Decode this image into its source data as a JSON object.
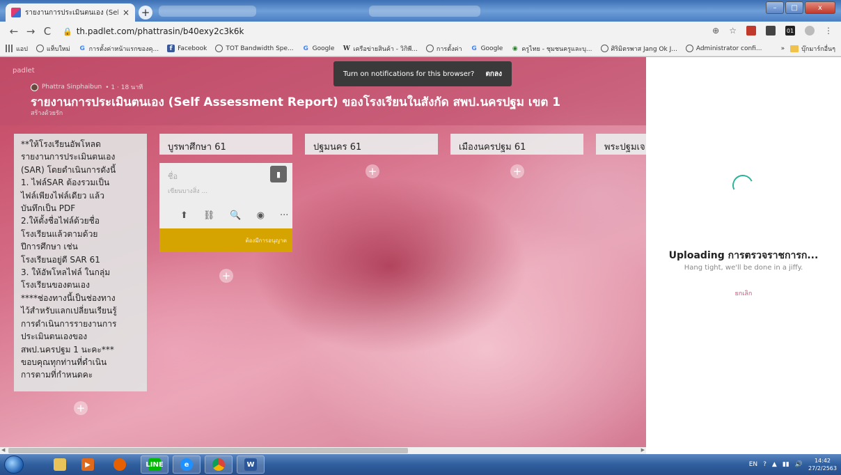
{
  "browser": {
    "tab_title": "รายงานการประเมินตนเอง (Self Assess",
    "tab_close": "×",
    "new_tab": "+",
    "back": "←",
    "forward": "→",
    "reload": "C",
    "lock": "🔒",
    "url": "th.padlet.com/phattrasin/b40exy2c3k6k",
    "icons": [
      "zoom-icon",
      "star-icon",
      "extension-icon",
      "profile-icon",
      "menu-icon"
    ]
  },
  "bookmarks": {
    "items": [
      {
        "label": "แอป",
        "icon": "apps-icon"
      },
      {
        "label": "แท็บใหม่",
        "icon": "globe-icon"
      },
      {
        "label": "การตั้งค่าหน้าแรกของคุ...",
        "icon": "google-icon"
      },
      {
        "label": "Facebook",
        "icon": "facebook-icon"
      },
      {
        "label": "TOT Bandwidth Spe...",
        "icon": "globe-icon"
      },
      {
        "label": "Google",
        "icon": "google-icon"
      },
      {
        "label": "เครือข่ายสินค้า - วิกิพี...",
        "icon": "wikipedia-icon"
      },
      {
        "label": "การตั้งค่า",
        "icon": "globe-icon"
      },
      {
        "label": "Google",
        "icon": "google-icon"
      },
      {
        "label": "ครูไทย - ชุมชนครูและบุ...",
        "icon": "green-icon"
      },
      {
        "label": "ศิริมิตรพาส Jang Ok J...",
        "icon": "globe-icon"
      },
      {
        "label": "Administrator confi...",
        "icon": "globe-icon"
      }
    ],
    "overflow": "»",
    "other_folder": "บุ๊กมาร์กอื่นๆ"
  },
  "padlet": {
    "logo": "padlet",
    "author": "Phattra Sinphaibun",
    "author_meta": "• 1 · 18 นาที",
    "title": "รายงานการประเมินตนเอง (Self Assessment Report) ของโรงเรียนในสังกัด สพป.นครปฐม เขต 1",
    "subtitle": "สร้างด้วยรัก",
    "toast_text": "Turn on notifications for this browser?",
    "toast_ok": "ตกลง",
    "note_text": "**ให้โรงเรียนอัพโหลด\nรายงานการประเมินตนเอง\n(SAR) โดยดำเนินการดังนี้\n1. ไฟล์SAR ต้องรวมเป็น\nไฟล์เพียงไฟล์เดียว แล้ว\nบันทึกเป็น PDF\n2.ให้ตั้งชื่อไฟล์ด้วยชื่อ\nโรงเรียนแล้วตามด้วย\nปีการศึกษา เช่น\nโรงเรียนอยู่ดี SAR 61\n3. ให้อัพโหลไฟล์ ในกลุ่ม\nโรงเรียนของตนเอง\n****ช่องทางนี้เป็นช่องทาง\nไว้สำหรับแลกเปลี่ยนเรียนรู้\nการดำเนินการรายงานการ\nประเมินตนเองของ\nสพป.นครปฐม 1 นะคะ***\nขอบคุณทุกท่านที่ดำเนิน\nการตามที่กำหนดคะ",
    "columns": [
      "บูรพาศึกษา 61",
      "ปฐมนคร 61",
      "เมืองนครปฐม 61",
      "พระปฐมเจ"
    ],
    "add": "+",
    "draft": {
      "name_placeholder": "ชื่อ",
      "body_placeholder": "เขียนบางสิ่ง ...",
      "trash": "▮",
      "tools": [
        "⬆",
        "⛓",
        "🔍",
        "◉",
        "···"
      ],
      "tool_names": [
        "upload-icon",
        "link-icon",
        "search-icon",
        "camera-icon",
        "more-icon"
      ],
      "approval": "ต้องมีการอนุญาต"
    }
  },
  "upload_panel": {
    "title": "Uploading การตรวจราชการก...",
    "subtitle": "Hang tight, we'll be done in a jiffy.",
    "cancel": "ยกเลิก"
  },
  "taskbar": {
    "apps": [
      "explorer",
      "media",
      "firefox",
      "line",
      "ie",
      "chrome",
      "word"
    ],
    "lang": "EN",
    "time": "14:42",
    "date": "27/2/2563"
  },
  "colors": {
    "accent_green": "#2ab39a",
    "cancel_pink": "#e04a7a",
    "approval_bar": "#d6a400"
  }
}
